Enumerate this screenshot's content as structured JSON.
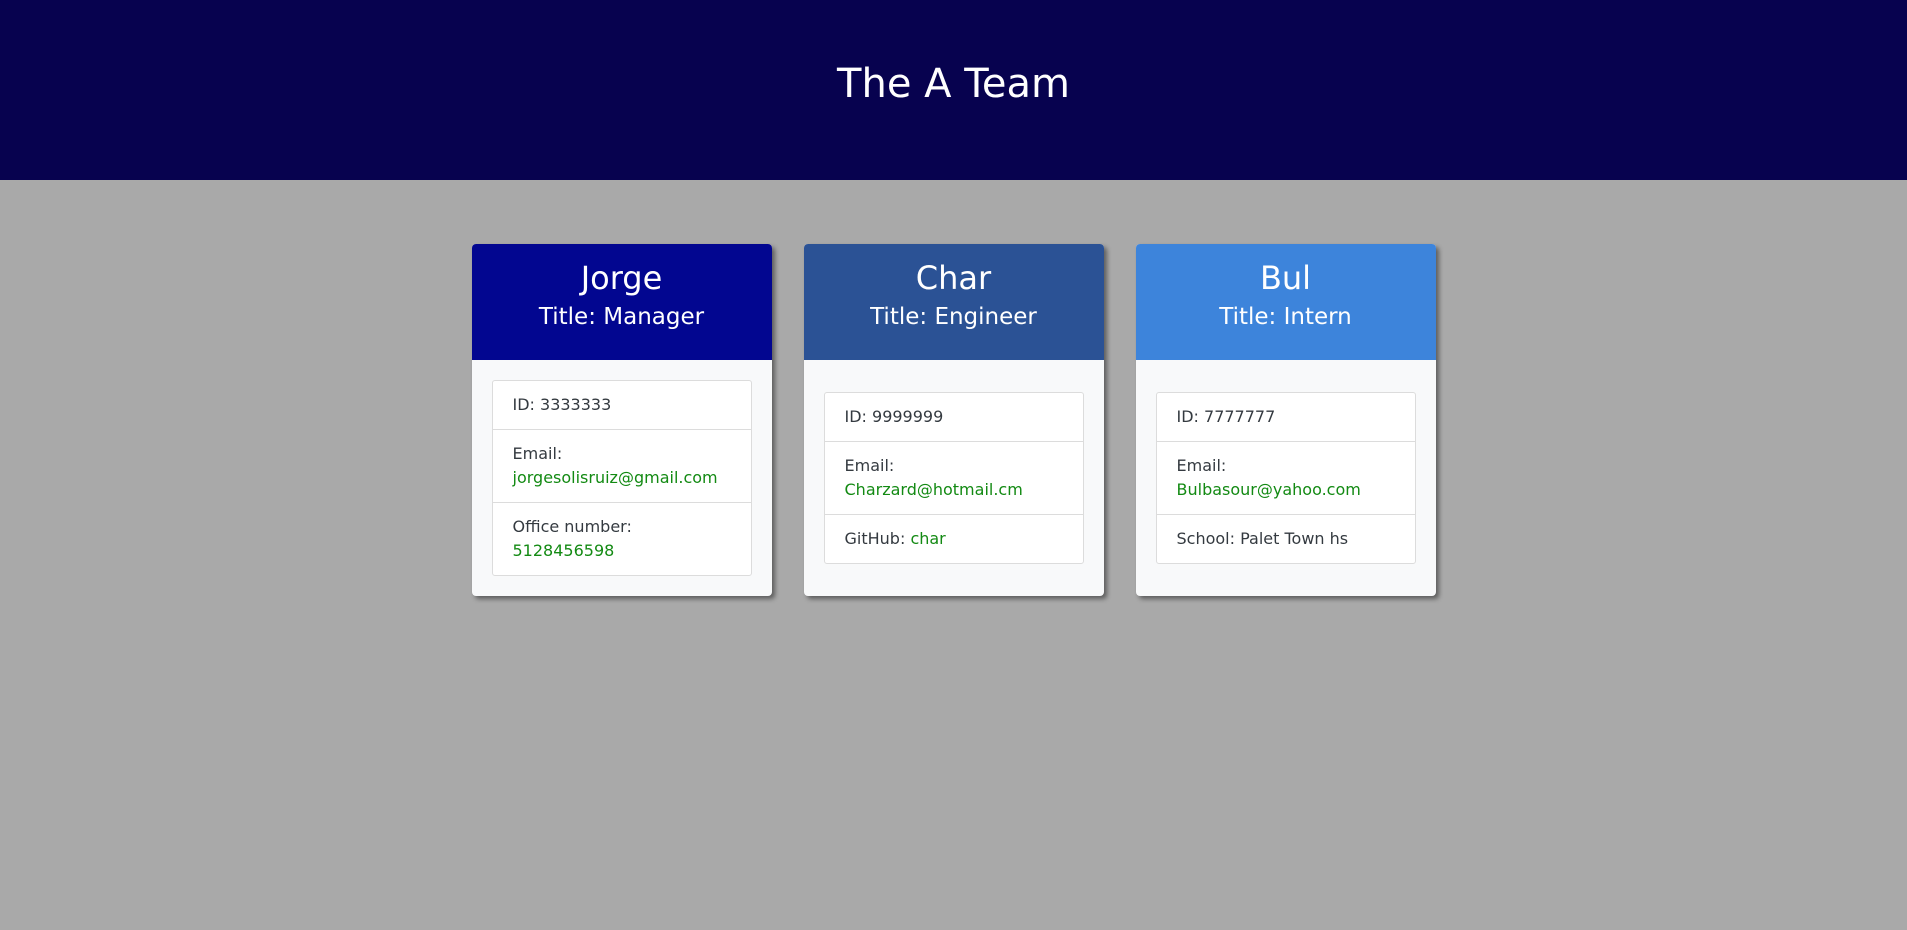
{
  "page": {
    "heading": "The A Team"
  },
  "colors": {
    "header_bg": "#07024f",
    "page_bg": "#a9a9a9",
    "manager_bg": "#020690",
    "engineer_bg": "#2b5295",
    "intern_bg": "#3d84db",
    "link": "#138a13"
  },
  "cards": [
    {
      "name": "Jorge",
      "title": "Title: Manager",
      "id": "ID: 3333333",
      "email_label": "Email:",
      "email": "jorgesolisruiz@gmail.com",
      "extra_label": "Office number:",
      "extra_value": "5128456598"
    },
    {
      "name": "Char",
      "title": "Title: Engineer",
      "id": "ID: 9999999",
      "email_label": "Email:",
      "email": "Charzard@hotmail.cm",
      "extra_label": "GitHub:",
      "extra_value": "char"
    },
    {
      "name": "Bul",
      "title": "Title: Intern",
      "id": "ID: 7777777",
      "email_label": "Email:",
      "email": "Bulbasour@yahoo.com",
      "extra_label": "School: Palet Town hs"
    }
  ]
}
